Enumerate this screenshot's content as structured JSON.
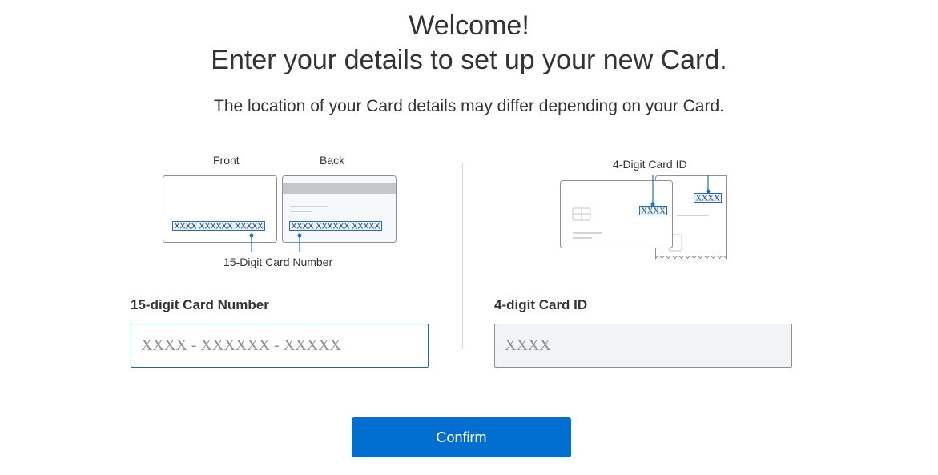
{
  "header": {
    "title_line1": "Welcome!",
    "title_line2": "Enter your details to set up your new Card.",
    "subtitle": "The location of your Card details may differ depending on your Card."
  },
  "illustration_left": {
    "front_label": "Front",
    "back_label": "Back",
    "number_mask": "XXXX XXXXXX XXXXX",
    "caption": "15-Digit Card Number"
  },
  "illustration_right": {
    "caption": "4-Digit Card ID",
    "id_mask": "XXXX"
  },
  "card_number": {
    "label": "15-digit Card Number",
    "placeholder": "XXXX - XXXXXX - XXXXX",
    "value": ""
  },
  "card_id": {
    "label": "4-digit Card ID",
    "placeholder": "XXXX",
    "value": ""
  },
  "actions": {
    "confirm_label": "Confirm"
  },
  "colors": {
    "accent": "#006fcf",
    "text": "#333333"
  }
}
